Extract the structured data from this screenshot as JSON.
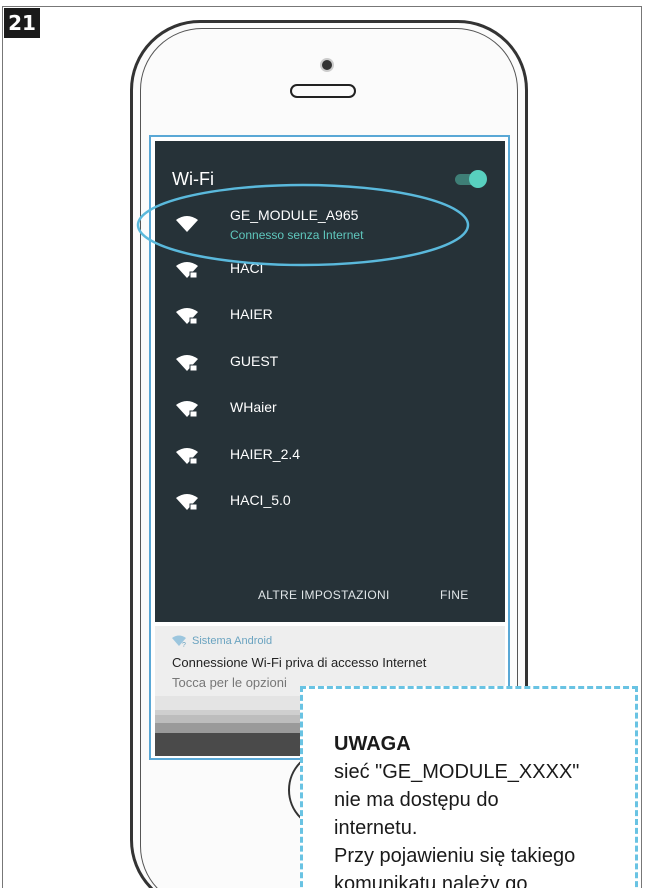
{
  "step_number": "21",
  "wifi": {
    "title": "Wi-Fi",
    "toggle_on": true,
    "networks": [
      {
        "name": "GE_MODULE_A965",
        "status": "Connesso senza Internet",
        "locked": false
      },
      {
        "name": "HACI",
        "locked": true
      },
      {
        "name": "HAIER",
        "locked": true
      },
      {
        "name": "GUEST",
        "locked": true
      },
      {
        "name": "WHaier",
        "locked": true
      },
      {
        "name": "HAIER_2.4",
        "locked": true
      },
      {
        "name": "HACI_5.0",
        "locked": true
      }
    ],
    "more_settings_label": "ALTRE IMPOSTAZIONI",
    "done_label": "FINE",
    "highlight_color": "#5ab9dc"
  },
  "notification": {
    "app": "Sistema Android",
    "title": "Connessione Wi-Fi priva di accesso Internet",
    "subtitle": "Tocca per le opzioni"
  },
  "note": {
    "title": "UWAGA",
    "lines": [
      "sieć \"GE_MODULE_XXXX\"",
      "nie ma dostępu do",
      "internetu.",
      "Przy pojawieniu się takiego",
      "komunikatu należy go"
    ],
    "border_color": "#69c3e3"
  },
  "colors": {
    "panel_bg": "#263238",
    "accent": "#58d0bf",
    "status_text": "#5fc7bd"
  }
}
